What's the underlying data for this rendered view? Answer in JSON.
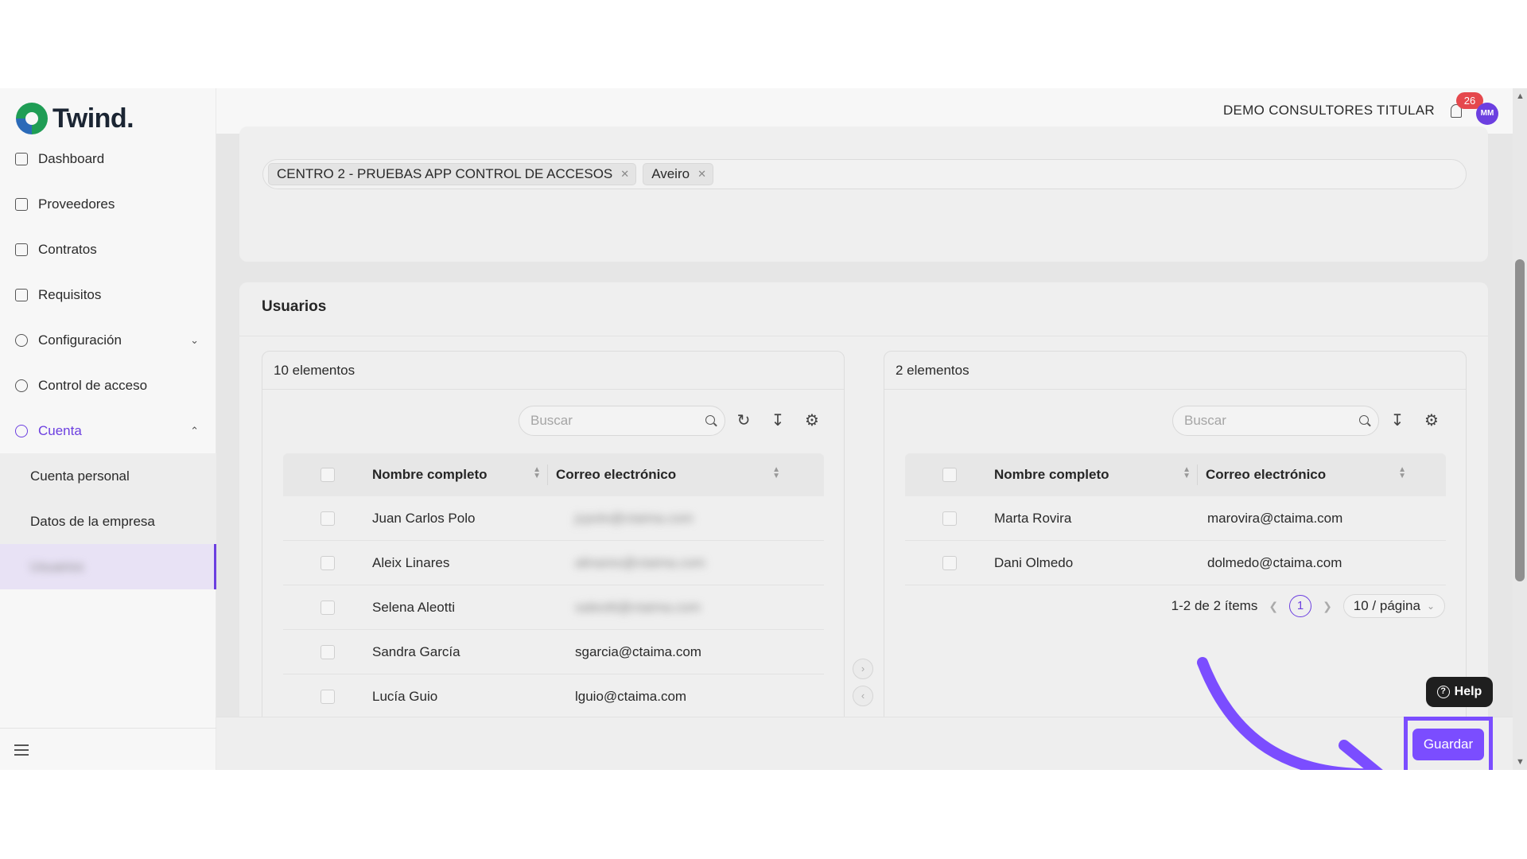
{
  "brand": {
    "name": "Twind."
  },
  "sidebar": {
    "items": [
      {
        "label": "Dashboard",
        "icon": "home-icon"
      },
      {
        "label": "Proveedores",
        "icon": "rocket-icon"
      },
      {
        "label": "Contratos",
        "icon": "contract-icon"
      },
      {
        "label": "Requisitos",
        "icon": "file-icon"
      },
      {
        "label": "Configuración",
        "icon": "gear-icon"
      },
      {
        "label": "Control de acceso",
        "icon": "key-icon"
      },
      {
        "label": "Cuenta",
        "icon": "account-icon"
      }
    ],
    "sub_items": [
      {
        "label": "Cuenta personal"
      },
      {
        "label": "Datos de la empresa"
      },
      {
        "label": "Usuarios"
      }
    ]
  },
  "header": {
    "company": "DEMO CONSULTORES TITULAR",
    "notifications": "26",
    "avatar": "MM"
  },
  "tags": [
    {
      "label": "CENTRO 2 - PRUEBAS APP CONTROL DE ACCESOS"
    },
    {
      "label": "Aveiro"
    }
  ],
  "users": {
    "title": "Usuarios",
    "left": {
      "count": "10 elementos",
      "search_placeholder": "Buscar",
      "columns": [
        "Nombre completo",
        "Correo electrónico"
      ],
      "rows": [
        {
          "name": "Juan Carlos Polo",
          "email": "jcpolo@ctaima.com",
          "blurred": true
        },
        {
          "name": "Aleix Linares",
          "email": "alinares@ctaima.com",
          "blurred": true
        },
        {
          "name": "Selena Aleotti",
          "email": "saleotti@ctaima.com",
          "blurred": true
        },
        {
          "name": "Sandra García",
          "email": "sgarcia@ctaima.com",
          "blurred": false
        },
        {
          "name": "Lucía Guio",
          "email": "lguio@ctaima.com",
          "blurred": false
        }
      ]
    },
    "right": {
      "count": "2 elementos",
      "search_placeholder": "Buscar",
      "columns": [
        "Nombre completo",
        "Correo electrónico"
      ],
      "rows": [
        {
          "name": "Marta Rovira",
          "email": "marovira@ctaima.com"
        },
        {
          "name": "Dani Olmedo",
          "email": "dolmedo@ctaima.com"
        }
      ],
      "pagination": {
        "summary": "1-2 de 2 ítems",
        "current": "1",
        "page_size": "10 / página"
      }
    }
  },
  "help": {
    "label": "Help"
  },
  "save": {
    "label": "Guardar"
  },
  "colors": {
    "accent": "#7b4dff",
    "badge": "#e5484d"
  }
}
